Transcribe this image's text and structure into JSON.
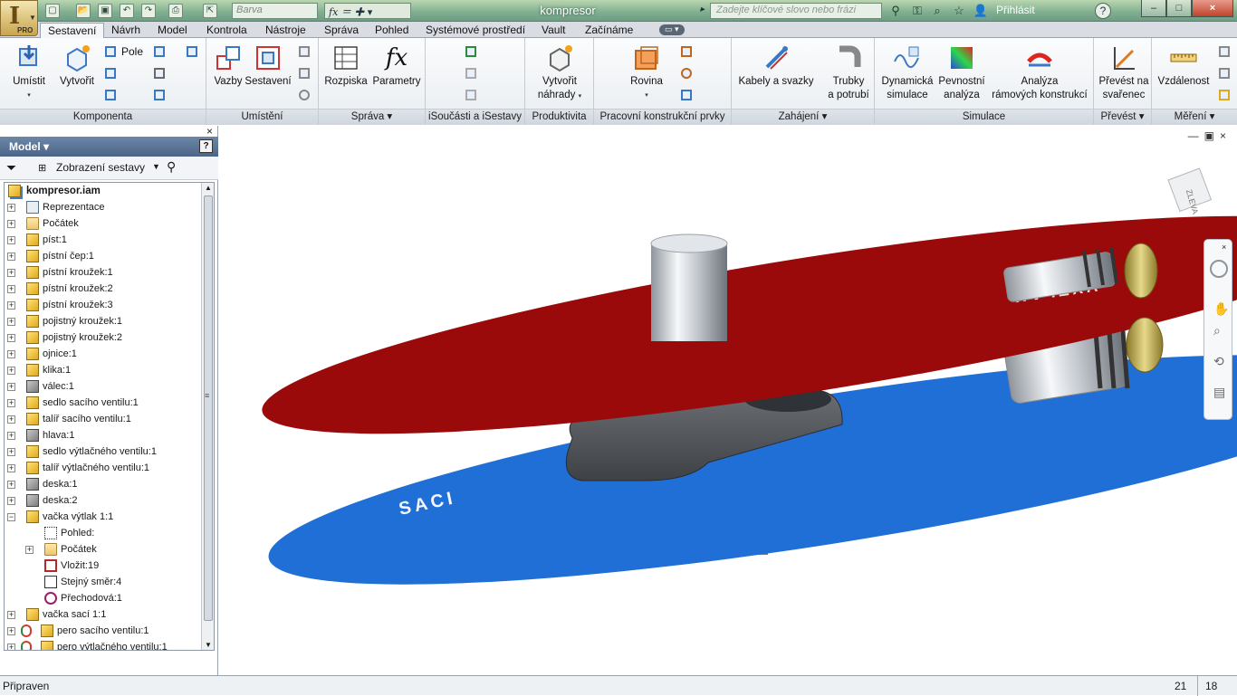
{
  "app": {
    "logo": "I",
    "edition": "PRO",
    "document_title": "kompresor"
  },
  "quick_access": {
    "box_text": "Barva",
    "fx_text": "fx"
  },
  "search": {
    "placeholder": "Zadejte klíčové slovo nebo frázi"
  },
  "user": {
    "signin": "Přihlásit"
  },
  "window_controls": {
    "minimize": "–",
    "maximize": "□",
    "close": "×"
  },
  "menu_tabs": [
    "Sestavení",
    "Návrh",
    "Model",
    "Kontrola",
    "Nástroje",
    "Správa",
    "Pohled",
    "Systémové prostředí",
    "Vault",
    "Začínáme"
  ],
  "ribbon": {
    "komponenta": {
      "label": "Komponenta",
      "umistit": "Umístit",
      "vytvorit": "Vytvořit",
      "pole": "Pole"
    },
    "umisteni": {
      "label": "Umístění",
      "vazby": "Vazby",
      "sestaveni": "Sestavení"
    },
    "sprava": {
      "label": "Správa",
      "rozpiska": "Rozpiska",
      "parametry": "Parametry"
    },
    "isoucasti": {
      "label": "iSoučásti a iSestavy"
    },
    "produktivita": {
      "label": "Produktivita",
      "vytvorit_nahrady_1": "Vytvořit",
      "vytvorit_nahrady_2": "náhrady"
    },
    "pracovni": {
      "label": "Pracovní konstrukční prvky",
      "rovina": "Rovina"
    },
    "zahajeni": {
      "label": "Zahájení",
      "kabely": "Kabely a svazky",
      "trubky_1": "Trubky",
      "trubky_2": "a potrubí"
    },
    "simulace": {
      "label": "Simulace",
      "dyn_1": "Dynamická",
      "dyn_2": "simulace",
      "pev_1": "Pevnostní",
      "pev_2": "analýza",
      "ram_1": "Analýza",
      "ram_2": "rámových konstrukcí"
    },
    "prevest": {
      "label": "Převést",
      "sv_1": "Převést na",
      "sv_2": "svařenec"
    },
    "mereni": {
      "label": "Měření",
      "vzdalenost": "Vzdálenost"
    }
  },
  "browser": {
    "title": "Model",
    "view_label": "Zobrazení sestavy",
    "root": "kompresor.iam",
    "items": [
      {
        "label": "Reprezentace",
        "icon": "representation-icon",
        "indent": 0,
        "pm": "+"
      },
      {
        "label": "Počátek",
        "icon": "folder-icon",
        "indent": 0,
        "pm": "+"
      },
      {
        "label": "píst:1",
        "icon": "part-icon",
        "indent": 0,
        "pm": "+"
      },
      {
        "label": "pístní čep:1",
        "icon": "part-icon",
        "indent": 0,
        "pm": "+"
      },
      {
        "label": "pístní kroužek:1",
        "icon": "part-icon",
        "indent": 0,
        "pm": "+"
      },
      {
        "label": "pístní kroužek:2",
        "icon": "part-icon",
        "indent": 0,
        "pm": "+"
      },
      {
        "label": "pístní kroužek:3",
        "icon": "part-icon",
        "indent": 0,
        "pm": "+"
      },
      {
        "label": "pojistný kroužek:1",
        "icon": "part-icon",
        "indent": 0,
        "pm": "+"
      },
      {
        "label": "pojistný kroužek:2",
        "icon": "part-icon",
        "indent": 0,
        "pm": "+"
      },
      {
        "label": "ojnice:1",
        "icon": "part-icon",
        "indent": 0,
        "pm": "+"
      },
      {
        "label": "klika:1",
        "icon": "part-icon",
        "indent": 0,
        "pm": "+"
      },
      {
        "label": "válec:1",
        "icon": "grey-part-icon",
        "indent": 0,
        "pm": "+"
      },
      {
        "label": "sedlo sacího ventilu:1",
        "icon": "part-icon",
        "indent": 0,
        "pm": "+"
      },
      {
        "label": "talíř sacího ventilu:1",
        "icon": "part-icon",
        "indent": 0,
        "pm": "+"
      },
      {
        "label": "hlava:1",
        "icon": "grey-part-icon",
        "indent": 0,
        "pm": "+"
      },
      {
        "label": "sedlo výtlačného ventilu:1",
        "icon": "part-icon",
        "indent": 0,
        "pm": "+"
      },
      {
        "label": "talíř výtlačného ventilu:1",
        "icon": "part-icon",
        "indent": 0,
        "pm": "+"
      },
      {
        "label": "deska:1",
        "icon": "grey-part-icon",
        "indent": 0,
        "pm": "+"
      },
      {
        "label": "deska:2",
        "icon": "grey-part-icon",
        "indent": 0,
        "pm": "+"
      },
      {
        "label": "vačka výtlak 1:1",
        "icon": "part-icon",
        "indent": 0,
        "pm": "−"
      },
      {
        "label": "Pohled:",
        "icon": "sketch-icon",
        "indent": 1,
        "pm": ""
      },
      {
        "label": "Počátek",
        "icon": "folder-icon",
        "indent": 1,
        "pm": "+"
      },
      {
        "label": "Vložit:19",
        "icon": "insert-constraint-icon",
        "indent": 1,
        "pm": ""
      },
      {
        "label": "Stejný směr:4",
        "icon": "flush-constraint-icon",
        "indent": 1,
        "pm": ""
      },
      {
        "label": "Přechodová:1",
        "icon": "tangent-constraint-icon",
        "indent": 1,
        "pm": ""
      },
      {
        "label": "vačka sací 1:1",
        "icon": "part-icon",
        "indent": 0,
        "pm": "+"
      },
      {
        "label": "pero sacího ventilu:1",
        "icon": "spring-part-icon",
        "indent": 0,
        "pm": "+"
      },
      {
        "label": "pero výtlačného ventilu:1",
        "icon": "spring-part-icon",
        "indent": 0,
        "pm": "+"
      }
    ]
  },
  "viewcube": {
    "face": "ZLEVA"
  },
  "viewport": {
    "top_text": "VYTLAK",
    "bottom_text": "SACI"
  },
  "status": {
    "text": "Připraven",
    "num1": "21",
    "num2": "18"
  },
  "colors": {
    "upper_disc": "#9b0a0a",
    "lower_disc": "#1f6fd6",
    "ribbon_tab_active": "#f4f6f8"
  }
}
